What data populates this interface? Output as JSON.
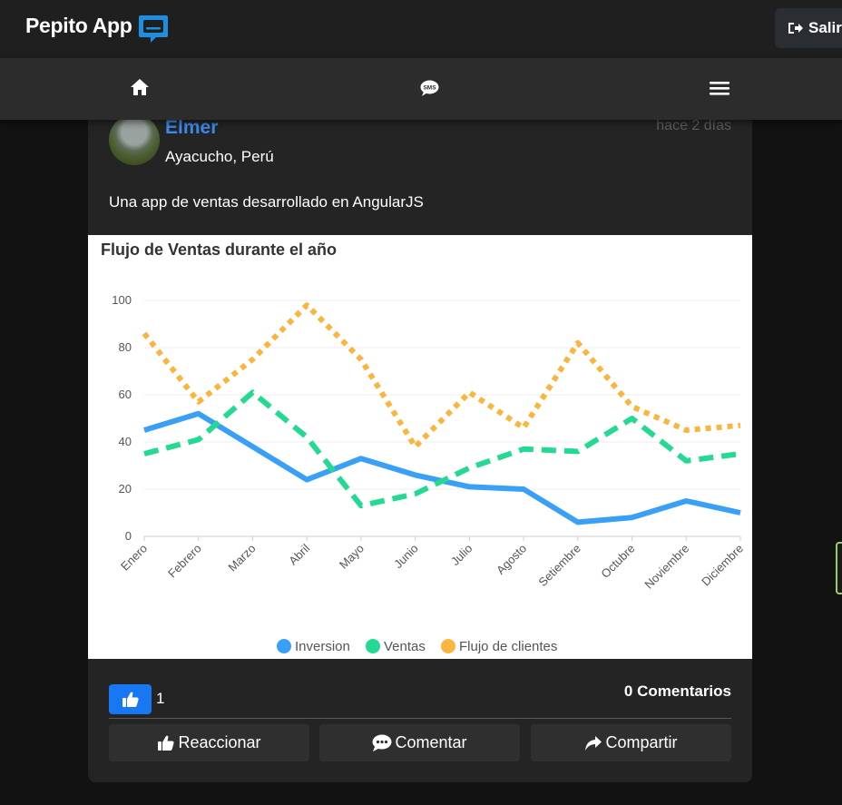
{
  "app": {
    "title": "Pepito App",
    "logout_label": "Salir"
  },
  "post": {
    "author": "Elmer",
    "location": "Ayacucho, Perú",
    "time": "hace 2 días",
    "text": "Una app de ventas desarrollado en AngularJS",
    "likes": "1",
    "comments": "0 Comentarios",
    "actions": {
      "react": "Reaccionar",
      "comment": "Comentar",
      "share": "Compartir"
    }
  },
  "colors": {
    "inversion": "#3aa0f5",
    "ventas": "#24d991",
    "flujo": "#f9b53e",
    "accent": "#3d8bef"
  },
  "chart_data": {
    "type": "line",
    "title": "Flujo de Ventas durante el año",
    "categories": [
      "Enero",
      "Febrero",
      "Marzo",
      "Abril",
      "Mayo",
      "Junio",
      "Julio",
      "Agosto",
      "Setiembre",
      "Octubre",
      "Noviembre",
      "Diciembre"
    ],
    "ylim": [
      0,
      100
    ],
    "yticks": [
      0,
      20,
      40,
      60,
      80,
      100
    ],
    "grid": true,
    "legend": "bottom",
    "series": [
      {
        "name": "Inversion",
        "color": "#3aa0f5",
        "dash": "solid",
        "values": [
          45,
          52,
          38,
          24,
          33,
          26,
          21,
          20,
          6,
          8,
          15,
          10
        ]
      },
      {
        "name": "Ventas",
        "color": "#24d991",
        "dash": "dashed",
        "values": [
          35,
          41,
          61,
          42,
          13,
          18,
          29,
          37,
          36,
          50,
          32,
          35
        ]
      },
      {
        "name": "Flujo de clientes",
        "color": "#f9b53e",
        "dash": "dotted",
        "values": [
          86,
          57,
          75,
          98,
          75,
          38,
          61,
          46,
          82,
          55,
          45,
          47
        ]
      }
    ]
  }
}
